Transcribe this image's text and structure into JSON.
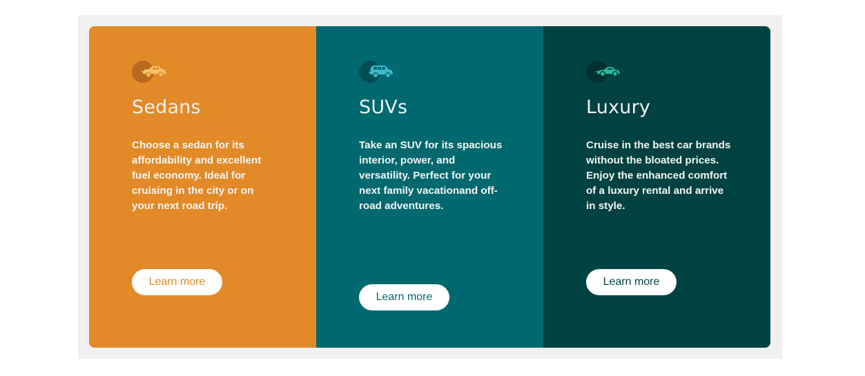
{
  "cards": [
    {
      "icon": "sedan-car-icon",
      "title": "Sedans",
      "description": "Choose a sedan for its affordability and excellent fuel economy. Ideal for cruising in the city or on your next road trip.",
      "button_label": "Learn more",
      "color": "#e28a28"
    },
    {
      "icon": "suv-car-icon",
      "title": "SUVs",
      "description": "Take an SUV for its spacious interior, power, and versatility. Perfect for your next family vacationand off-road adventures.",
      "button_label": "Learn more",
      "color": "#006970"
    },
    {
      "icon": "luxury-car-icon",
      "title": "Luxury",
      "description": "Cruise in the best car brands without the bloated prices. Enjoy the enhanced comfort of a luxury rental and arrive in style.",
      "button_label": "Learn more",
      "color": "#004241"
    }
  ],
  "colors": {
    "frame_background": "#f0f0f0",
    "icon_sedan": "#f5c26b",
    "icon_suv": "#3fb8c9",
    "icon_luxury": "#2bb89c"
  }
}
